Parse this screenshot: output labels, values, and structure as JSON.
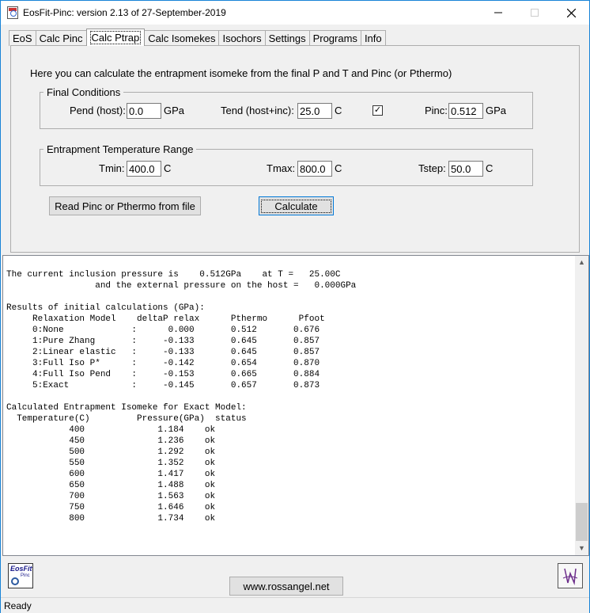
{
  "window": {
    "title": "EosFit-Pinc:  version  2.13 of 27-September-2019"
  },
  "tabs": [
    "EoS",
    "Calc Pinc",
    "Calc Ptrap",
    "Calc Isomekes",
    "Isochors",
    "Settings",
    "Programs",
    "Info"
  ],
  "active_tab": "Calc Ptrap",
  "panel": {
    "intro": "Here you can calculate the entrapment isomeke from the final P and T and Pinc (or Pthermo)",
    "final": {
      "legend": "Final Conditions",
      "pend_label": "Pend (host):",
      "pend_value": "0.0",
      "pend_unit": "GPa",
      "tend_label": "Tend (host+inc):",
      "tend_value": "25.0",
      "tend_unit": "C",
      "checkbox_checked": true,
      "pinc_label": "Pinc:",
      "pinc_value": "0.512",
      "pinc_unit": "GPa"
    },
    "range": {
      "legend": "Entrapment Temperature Range",
      "tmin_label": "Tmin:",
      "tmin_value": "400.0",
      "tmin_unit": "C",
      "tmax_label": "Tmax:",
      "tmax_value": "800.0",
      "tmax_unit": "C",
      "tstep_label": "Tstep:",
      "tstep_value": "50.0",
      "tstep_unit": "C"
    },
    "read_button": "Read Pinc or Pthermo from file",
    "calc_button": "Calculate"
  },
  "output": {
    "lines": [
      "The current inclusion pressure is    0.512GPa    at T =   25.00C",
      "                 and the external pressure on the host =   0.000GPa",
      "",
      "Results of initial calculations (GPa):",
      "     Relaxation Model    deltaP relax      Pthermo      Pfoot",
      "     0:None             :      0.000       0.512       0.676",
      "     1:Pure Zhang       :     -0.133       0.645       0.857",
      "     2:Linear elastic   :     -0.133       0.645       0.857",
      "     3:Full Iso P*      :     -0.142       0.654       0.870",
      "     4:Full Iso Pend    :     -0.153       0.665       0.884",
      "     5:Exact            :     -0.145       0.657       0.873",
      "",
      "Calculated Entrapment Isomeke for Exact Model:",
      "  Temperature(C)         Pressure(GPa)  status",
      "            400              1.184    ok",
      "            450              1.236    ok",
      "            500              1.292    ok",
      "            550              1.352    ok",
      "            600              1.417    ok",
      "            650              1.488    ok",
      "            700              1.563    ok",
      "            750              1.646    ok",
      "            800              1.734    ok"
    ]
  },
  "footer": {
    "logo_left_text": "EosFit",
    "logo_left_sub": "Pinc",
    "url": "www.rossangel.net"
  },
  "status": "Ready"
}
